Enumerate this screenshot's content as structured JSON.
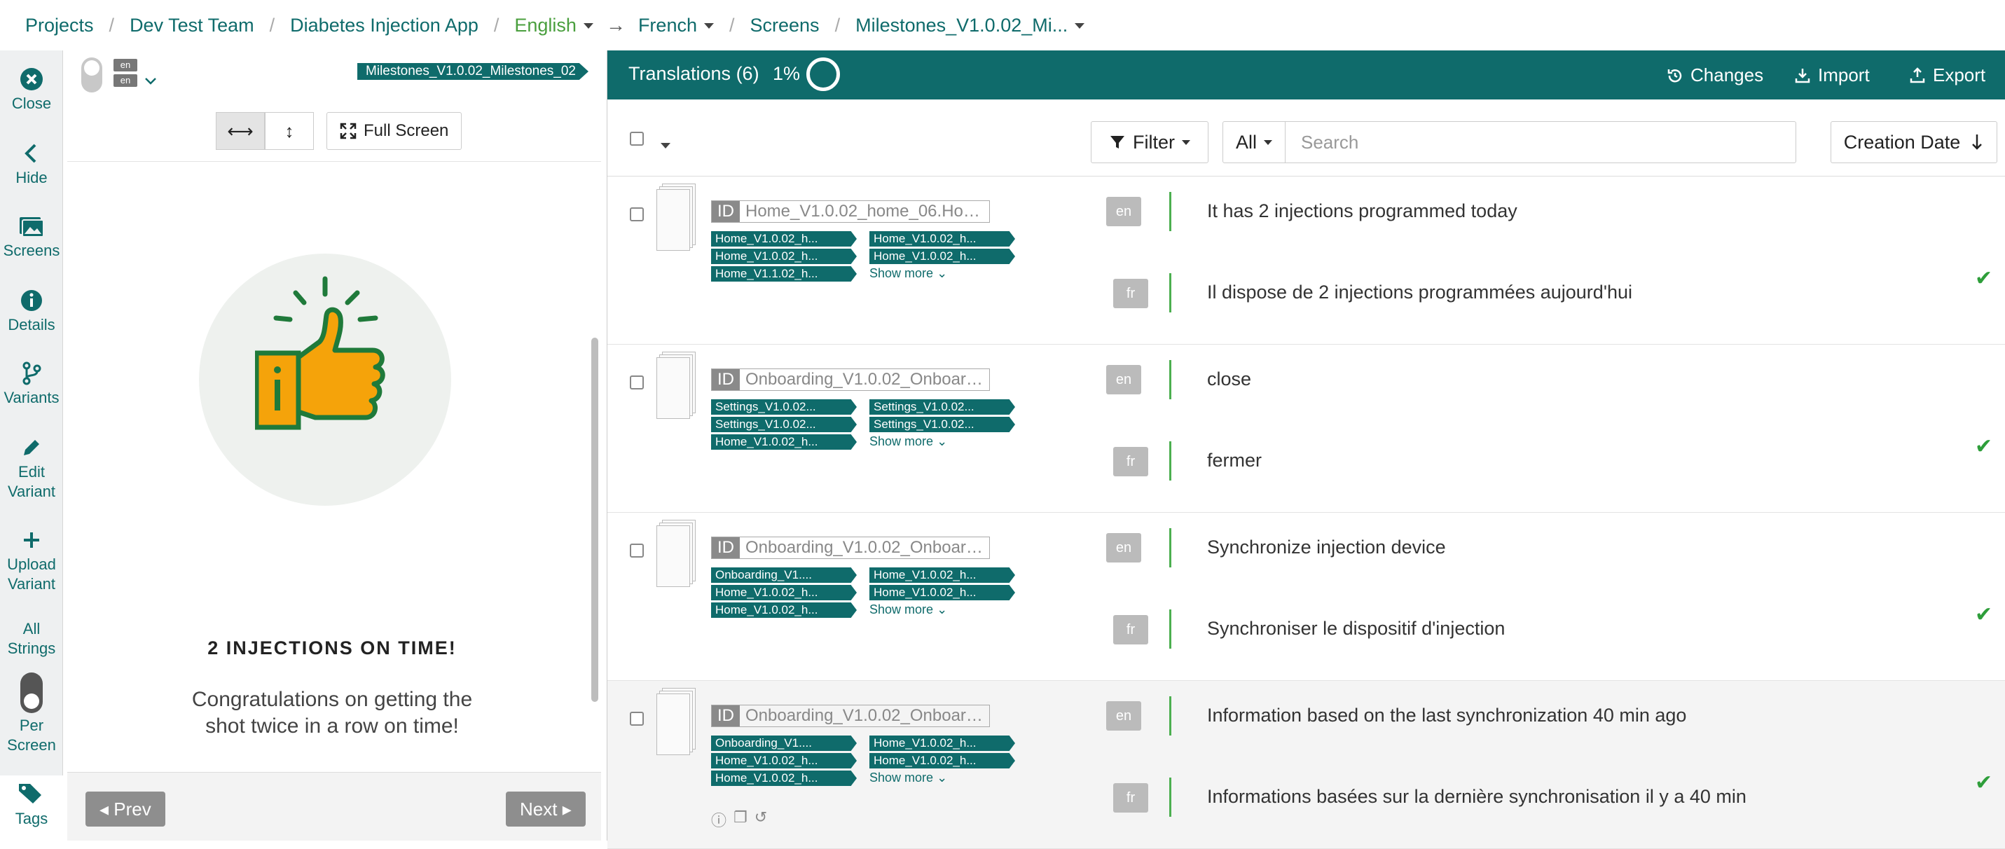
{
  "breadcrumb": {
    "projects": "Projects",
    "team": "Dev Test Team",
    "app": "Diabetes Injection App",
    "source_lang": "English",
    "target_lang": "French",
    "screens": "Screens",
    "screen": "Milestones_V1.0.02_Mi..."
  },
  "rail": {
    "close": "Close",
    "hide": "Hide",
    "screens": "Screens",
    "details": "Details",
    "variants": "Variants",
    "edit_variant_1": "Edit",
    "edit_variant_2": "Variant",
    "upload_variant_1": "Upload",
    "upload_variant_2": "Variant",
    "all_strings_1": "All",
    "all_strings_2": "Strings",
    "per_screen_1": "Per",
    "per_screen_2": "Screen",
    "tags": "Tags"
  },
  "preview": {
    "lang_top": "en",
    "lang_bottom": "en",
    "screen_tag": "Milestones_V1.0.02_Milestones_02",
    "fullscreen": "Full Screen",
    "title": "2 INJECTIONS ON TIME!",
    "body": "Congratulations on getting the shot twice in a row on time!",
    "prev": "Prev",
    "next": "Next"
  },
  "translations": {
    "title": "Translations (6)",
    "percent": "1%",
    "changes": "Changes",
    "import": "Import",
    "export": "Export",
    "filter": "Filter",
    "scope": "All",
    "search_placeholder": "Search",
    "sort": "Creation Date",
    "id_label": "ID",
    "show_more": "Show more",
    "rows": [
      {
        "id": "Home_V1.0.02_home_06.Hom...",
        "chips": [
          "Home_V1.0.02_h...",
          "Home_V1.0.02_h...",
          "Home_V1.0.02_h...",
          "Home_V1.0.02_h...",
          "Home_V1.1.02_h..."
        ],
        "en": "It has 2 injections programmed today",
        "fr": "Il dispose de 2 injections programmées aujourd'hui"
      },
      {
        "id": "Onboarding_V1.0.02_Onboardi...",
        "chips": [
          "Settings_V1.0.02...",
          "Settings_V1.0.02...",
          "Settings_V1.0.02...",
          "Settings_V1.0.02...",
          "Home_V1.0.02_h..."
        ],
        "en": "close",
        "fr": "fermer"
      },
      {
        "id": "Onboarding_V1.0.02_Onboardi...",
        "chips": [
          "Onboarding_V1....",
          "Home_V1.0.02_h...",
          "Home_V1.0.02_h...",
          "Home_V1.0.02_h...",
          "Home_V1.0.02_h..."
        ],
        "en": "Synchronize injection device",
        "fr": "Synchroniser le dispositif d'injection"
      },
      {
        "id": "Onboarding_V1.0.02_Onboardi...",
        "chips": [
          "Onboarding_V1....",
          "Home_V1.0.02_h...",
          "Home_V1.0.02_h...",
          "Home_V1.0.02_h...",
          "Home_V1.0.02_h..."
        ],
        "en": "Information based on the last synchronization 40 min ago",
        "fr": "Informations basées sur la dernière synchronisation il y a 40 min"
      }
    ],
    "lang_en": "en",
    "lang_fr": "fr"
  },
  "colors": {
    "accent": "#0f6b6b",
    "success": "#2e9e3a",
    "thumb_orange": "#f5a30a",
    "thumb_green": "#1f7a3a"
  }
}
